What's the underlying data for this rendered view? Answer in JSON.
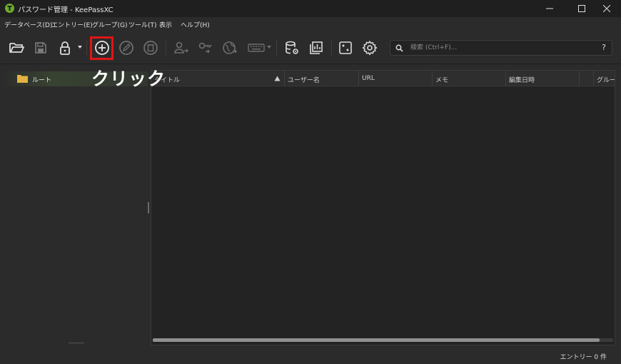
{
  "window": {
    "title": "パスワード管理 - KeePassXC",
    "app_icon": "keepassxc-logo-icon"
  },
  "menu": [
    {
      "label": "データベース(D)"
    },
    {
      "label": "エントリー(E)"
    },
    {
      "label": "グループ(G)"
    },
    {
      "label": "ツール(T)"
    },
    {
      "label": "表示"
    },
    {
      "label": "ヘルプ(H)"
    }
  ],
  "toolbar": {
    "buttons": [
      {
        "icon": "open-folder-icon",
        "enabled": true
      },
      {
        "icon": "save-icon",
        "enabled": false
      },
      {
        "icon": "lock-icon",
        "enabled": true
      },
      {
        "icon": "add-entry-icon",
        "enabled": true,
        "highlighted": true
      },
      {
        "icon": "edit-entry-icon",
        "enabled": false
      },
      {
        "icon": "delete-entry-icon",
        "enabled": false
      },
      {
        "icon": "copy-username-icon",
        "enabled": false
      },
      {
        "icon": "copy-password-icon",
        "enabled": false
      },
      {
        "icon": "open-url-icon",
        "enabled": false
      },
      {
        "icon": "autotype-keyboard-icon",
        "enabled": false
      },
      {
        "icon": "database-settings-icon",
        "enabled": true
      },
      {
        "icon": "reports-icon",
        "enabled": true
      },
      {
        "icon": "password-generator-icon",
        "enabled": true
      },
      {
        "icon": "settings-gear-icon",
        "enabled": true
      }
    ],
    "highlight_color": "#e01616"
  },
  "search": {
    "placeholder": "検索 (Ctrl+F)...",
    "value": "",
    "help_label": "?"
  },
  "groups": [
    {
      "label": "ルート",
      "icon": "folder-icon",
      "selected": true
    }
  ],
  "entries_table": {
    "columns": [
      {
        "label": "タイトル",
        "sorted": "ascending"
      },
      {
        "label": "ユーザー名"
      },
      {
        "label": "URL"
      },
      {
        "label": "メモ"
      },
      {
        "label": "編集日時"
      },
      {
        "label": "グループ"
      }
    ],
    "rows": []
  },
  "annotation": {
    "text": "クリック"
  },
  "status": {
    "entry_count": "エントリー 0 件"
  },
  "colors": {
    "accent_green": "#6cab2e",
    "folder_yellow": "#e3b341",
    "background": "#2b2b2b",
    "panel": "#232323"
  }
}
